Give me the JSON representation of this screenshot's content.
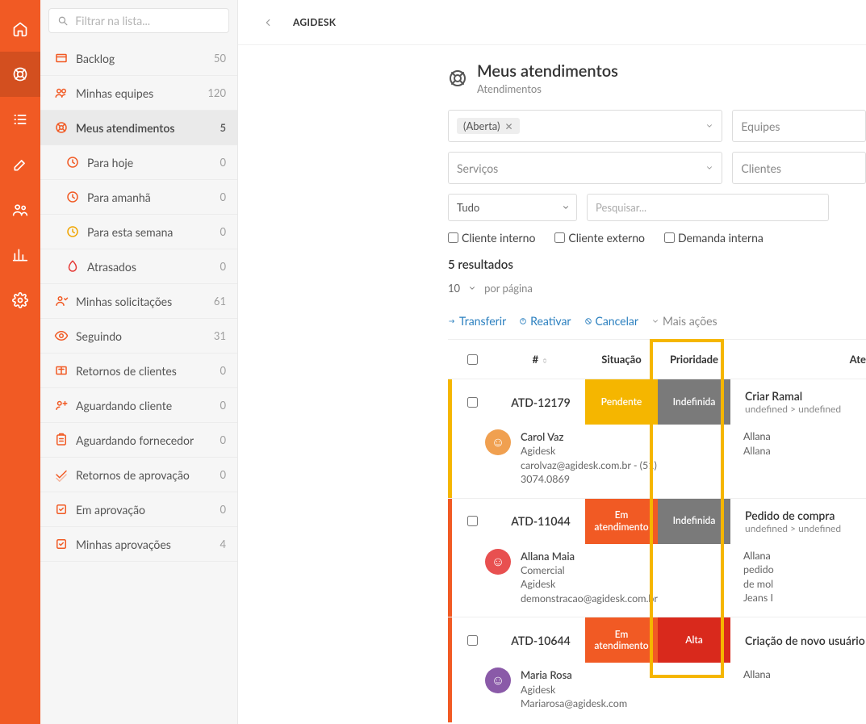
{
  "search_placeholder": "Filtrar na lista...",
  "app_name": "AGIDESK",
  "page_title": "Meus atendimentos",
  "page_subtitle": "Atendimentos",
  "nav": [
    {
      "label": "Backlog",
      "count": "50"
    },
    {
      "label": "Minhas equipes",
      "count": "120"
    },
    {
      "label": "Meus atendimentos",
      "count": "5"
    },
    {
      "label": "Para hoje",
      "count": "0"
    },
    {
      "label": "Para amanhã",
      "count": "0"
    },
    {
      "label": "Para esta semana",
      "count": "0"
    },
    {
      "label": "Atrasados",
      "count": "0"
    },
    {
      "label": "Minhas solicitações",
      "count": "61"
    },
    {
      "label": "Seguindo",
      "count": "31"
    },
    {
      "label": "Retornos de clientes",
      "count": "0"
    },
    {
      "label": "Aguardando cliente",
      "count": "0"
    },
    {
      "label": "Aguardando fornecedor",
      "count": "0"
    },
    {
      "label": "Retornos de aprovação",
      "count": "0"
    },
    {
      "label": "Em aprovação",
      "count": "0"
    },
    {
      "label": "Minhas aprovações",
      "count": "4"
    }
  ],
  "filters": {
    "status_chip": "(Aberta)",
    "equipes": "Equipes",
    "servicos": "Serviços",
    "clientes": "Clientes",
    "scope": "Tudo",
    "search": "Pesquisar...",
    "chk1": "Cliente interno",
    "chk2": "Cliente externo",
    "chk3": "Demanda interna"
  },
  "results_label": "5 resultados",
  "perpage_n": "10",
  "perpage_lbl": "por página",
  "actions": {
    "transfer": "Transferir",
    "reactivate": "Reativar",
    "cancel": "Cancelar",
    "more": "Mais ações"
  },
  "columns": {
    "id": "#",
    "sit": "Situação",
    "pri": "Prioridade",
    "ate": "Ate"
  },
  "rows": [
    {
      "id": "ATD-12179",
      "sit": "Pendente",
      "sit_cls": "b-yellow",
      "pri": "Indefinida",
      "pri_cls": "b-gray",
      "bar": "#f5b600",
      "title": "Criar Ramal",
      "path": "undefined > undefined",
      "person": {
        "name": "Carol Vaz",
        "l1": "Agidesk",
        "l2": "carolvaz@agidesk.com.br - (51)",
        "l3": "3074.0869"
      },
      "meta": {
        "n": "Allana",
        "l1": "Allana"
      }
    },
    {
      "id": "ATD-11044",
      "sit": "Em atendimento",
      "sit_cls": "b-orange",
      "pri": "Indefinida",
      "pri_cls": "b-gray",
      "bar": "#f15a24",
      "title": "Pedido de compra",
      "path": "undefined > undefined",
      "person": {
        "name": "Allana Maia",
        "l1": "Comercial",
        "l2": "Agidesk",
        "l3": "demonstracao@agidesk.com.br"
      },
      "meta": {
        "n": "Allana",
        "l1": "pedido",
        "l2": "de mol",
        "l3": "Jeans I"
      }
    },
    {
      "id": "ATD-10644",
      "sit": "Em atendimento",
      "sit_cls": "b-orange",
      "pri": "Alta",
      "pri_cls": "b-red",
      "bar": "#f15a24",
      "title": "Criação de novo usuário",
      "path": "",
      "person": {
        "name": "Maria Rosa",
        "l1": "Agidesk",
        "l2": "Mariarosa@agidesk.com",
        "l3": ""
      },
      "meta": {
        "n": "Allana",
        "l1": ""
      }
    }
  ]
}
